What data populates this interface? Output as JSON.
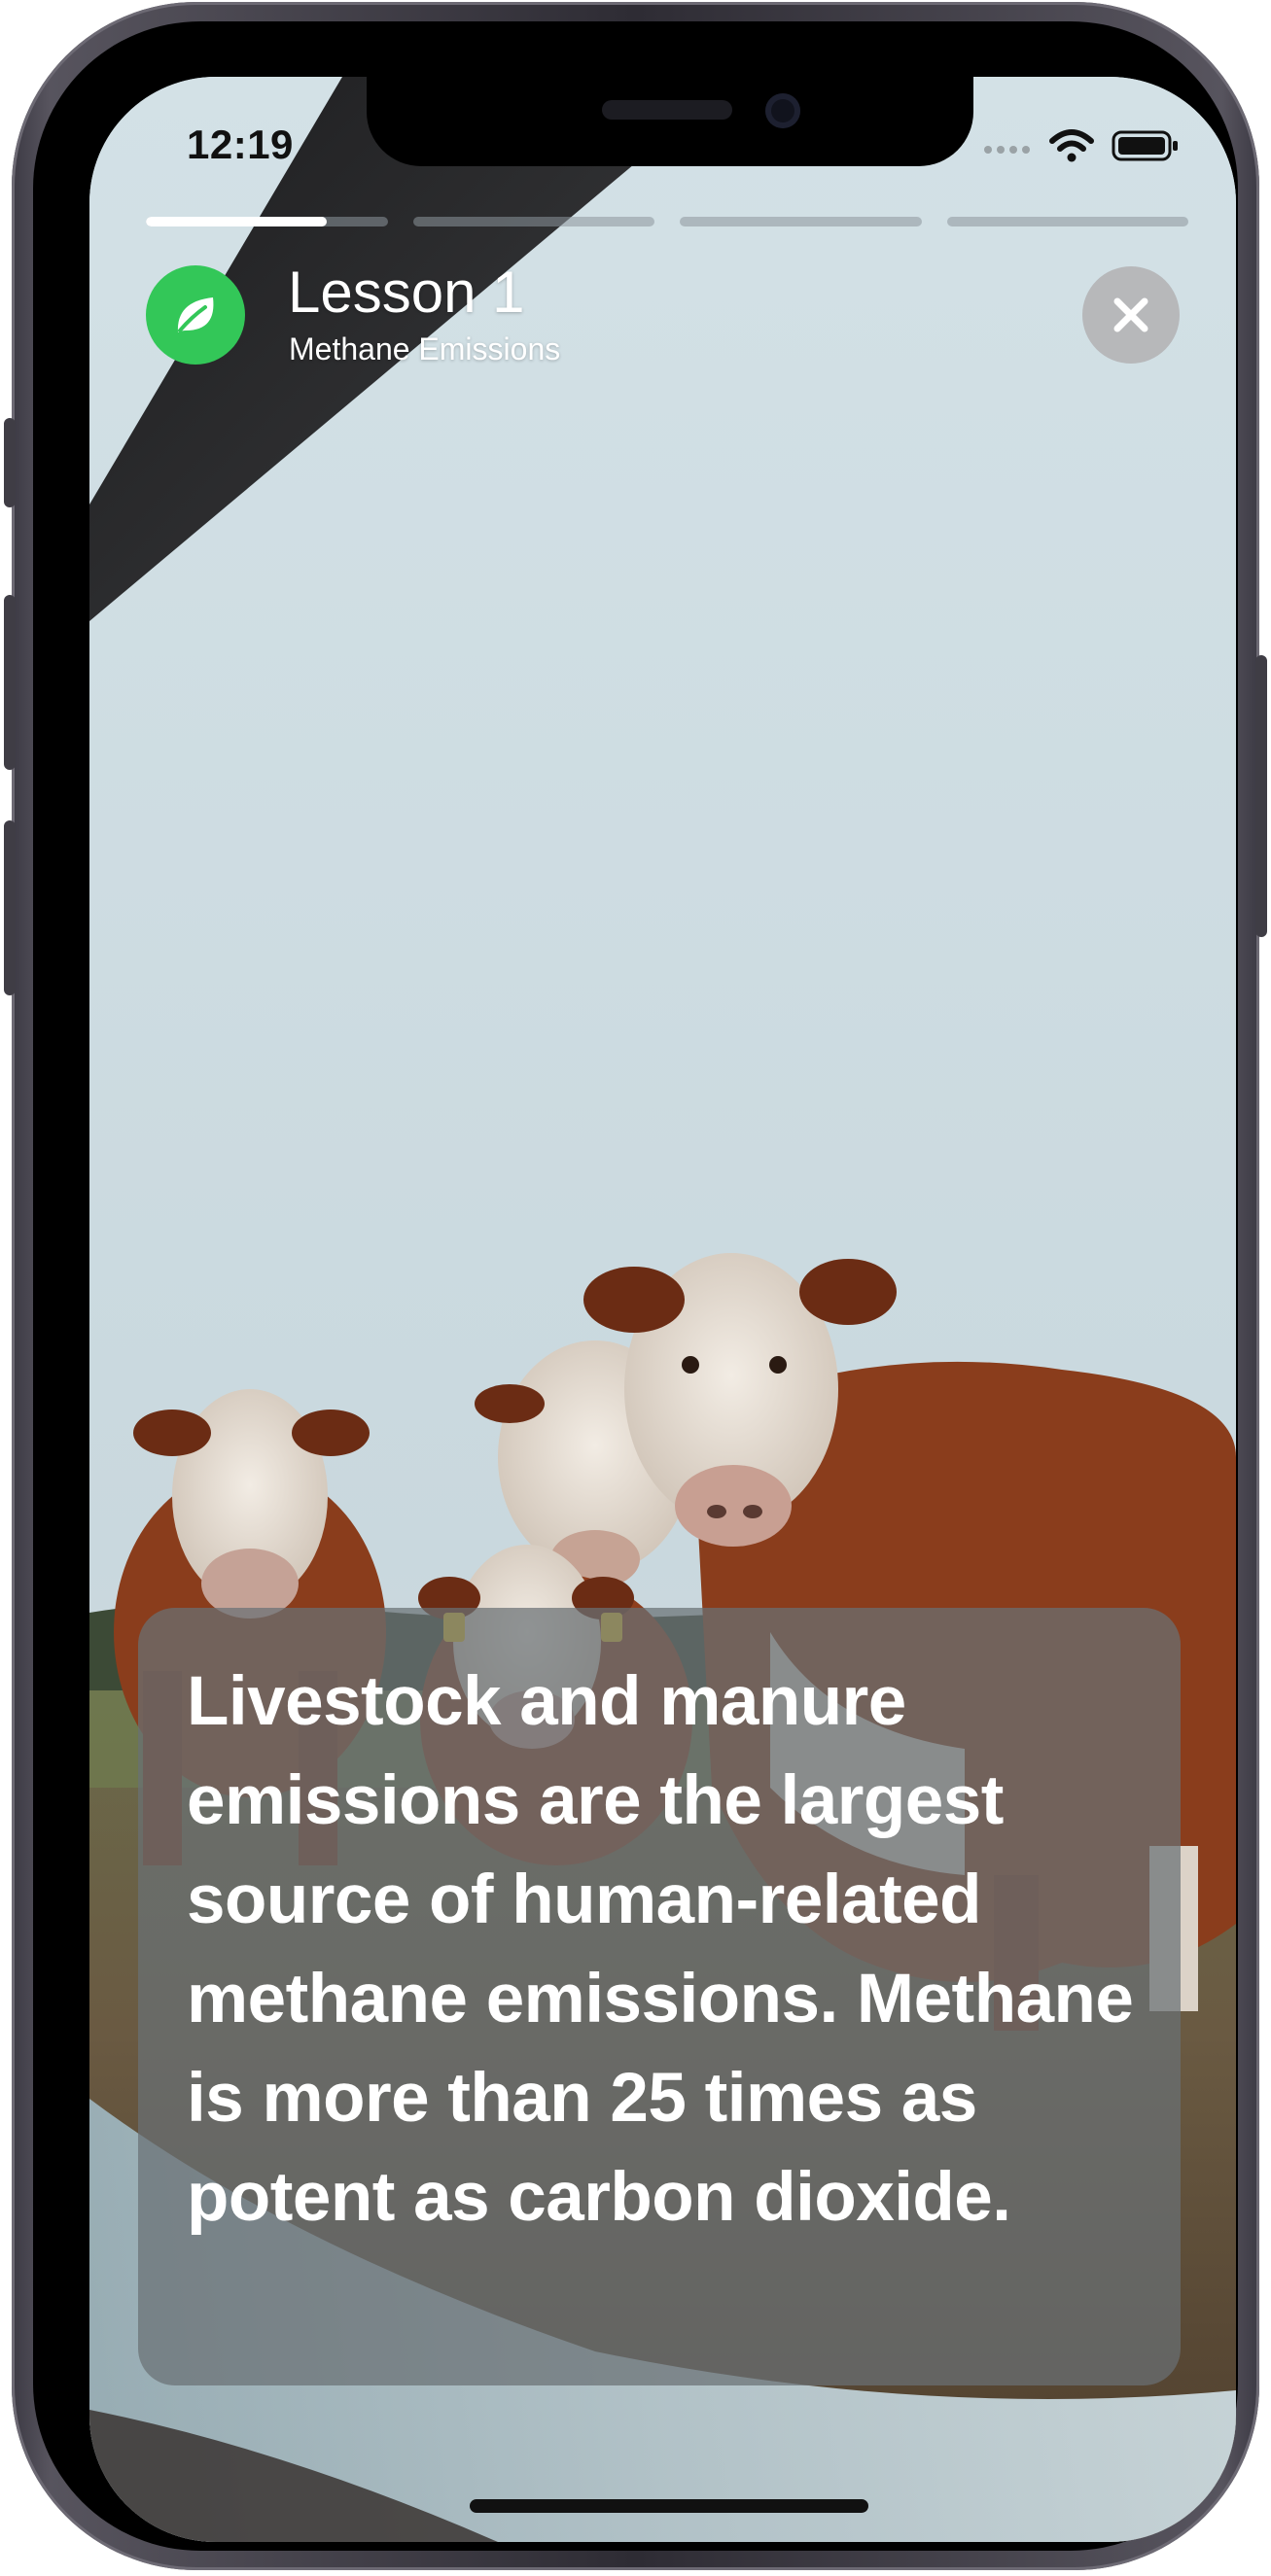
{
  "status_bar": {
    "time": "12:19",
    "icons": [
      "cellular-signal-icon",
      "wifi-icon",
      "battery-icon"
    ]
  },
  "story": {
    "segments": [
      {
        "progress": 0.75
      },
      {
        "progress": 0
      },
      {
        "progress": 0
      },
      {
        "progress": 0
      }
    ]
  },
  "lesson": {
    "title": "Lesson 1",
    "subtitle": "Methane Emissions",
    "icon": "leaf-icon",
    "icon_color": "#33c758"
  },
  "close": {
    "icon": "close-icon"
  },
  "fact": {
    "text": "Livestock and manure emissions are the largest source of human-related methane emissions. Methane is more than 25 times as potent as carbon dioxide."
  },
  "background": {
    "description_icon": "cows-photo",
    "sky_color": "#cfdde2",
    "cow_color": "#8a3d1c"
  }
}
